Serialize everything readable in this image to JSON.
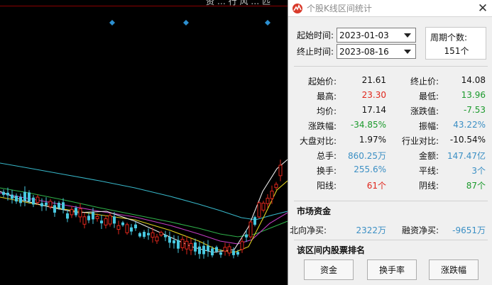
{
  "chart_header": {
    "clipped_text": "资 … 行 风 … 匹"
  },
  "dialog": {
    "title": "个股K线区间统计",
    "close_label": "✕",
    "start_time_label": "起始时间:",
    "start_date": "2023-01-03",
    "end_time_label": "终止时间:",
    "end_date": "2023-08-16",
    "period_label": "周期个数:",
    "period_value": "151个",
    "stats": [
      {
        "l1": "起始价:",
        "v1": "21.61",
        "c1": "#111111",
        "l2": "终止价:",
        "v2": "14.08",
        "c2": "#111111"
      },
      {
        "l1": "最高:",
        "v1": "23.30",
        "c1": "#e0261c",
        "l2": "最低:",
        "v2": "13.96",
        "c2": "#1b9a2c"
      },
      {
        "l1": "均价:",
        "v1": "17.14",
        "c1": "#111111",
        "l2": "涨跌值:",
        "v2": "-7.53",
        "c2": "#1b9a2c"
      },
      {
        "l1": "涨跌幅:",
        "v1": "-34.85%",
        "c1": "#1b9a2c",
        "l2": "振幅:",
        "v2": "43.22%",
        "c2": "#3b8fc4"
      },
      {
        "l1": "大盘对比:",
        "v1": "1.97%",
        "c1": "#111111",
        "l2": "行业对比:",
        "v2": "-10.54%",
        "c2": "#111111"
      },
      {
        "l1": "总手:",
        "v1": "860.25万",
        "c1": "#3b8fc4",
        "l2": "金额:",
        "v2": "147.47亿",
        "c2": "#3b8fc4"
      },
      {
        "l1": "换手:",
        "v1": "255.6%",
        "c1": "#3b8fc4",
        "l2": "平线:",
        "v2": "3个",
        "c2": "#3b8fc4"
      },
      {
        "l1": "阳线:",
        "v1": "61个",
        "c1": "#e0261c",
        "l2": "阴线:",
        "v2": "87个",
        "c2": "#1b9a2c"
      }
    ],
    "market_funds_title": "市场资金",
    "northbound_label": "北向净买:",
    "northbound_value": "2322万",
    "margin_label": "融资净买:",
    "margin_value": "-9651万",
    "ranking_title": "该区间内股票排名",
    "buttons": {
      "funds": "资金",
      "turnover": "换手率",
      "change": "涨跌幅"
    }
  },
  "colors": {
    "up": "#e0261c",
    "down": "#1b9a2c",
    "blue": "#3b8fc4",
    "chart_bg": "#000000"
  },
  "icons": {
    "app": "stock-chart-logo-icon",
    "close": "close-icon",
    "dropdown": "chevron-down-icon",
    "chart_marker": "diamond-marker-icon"
  }
}
